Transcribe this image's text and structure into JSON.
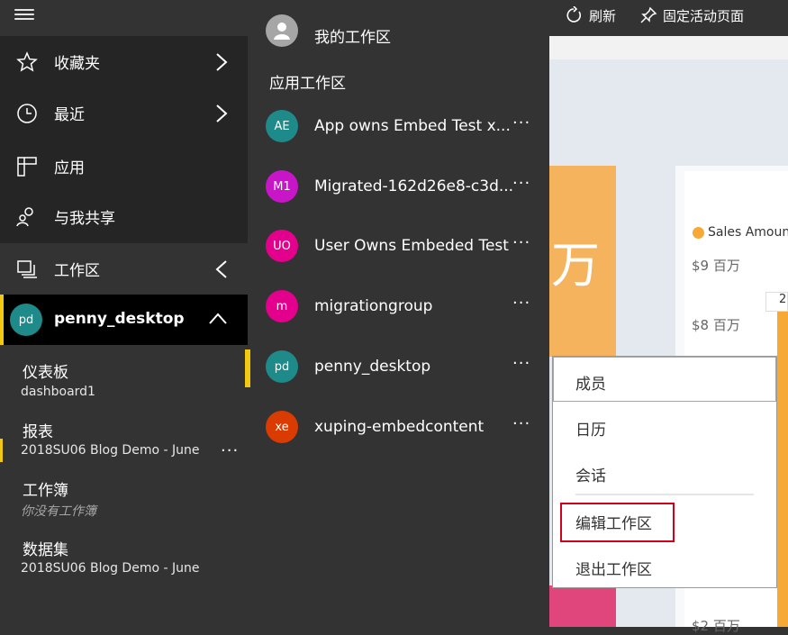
{
  "topbar": {
    "refresh_label": "刷新",
    "pin_label": "固定活动页面"
  },
  "nav": {
    "favorites": "收藏夹",
    "recent": "最近",
    "apps": "应用",
    "shared": "与我共享",
    "workspaces": "工作区"
  },
  "active_workspace": {
    "initials": "pd",
    "name": "penny_desktop",
    "sections": {
      "dashboards_title": "仪表板",
      "dashboards_item": "dashboard1",
      "reports_title": "报表",
      "reports_item": "2018SU06 Blog Demo - June",
      "workbooks_title": "工作簿",
      "workbooks_empty": "你没有工作簿",
      "datasets_title": "数据集",
      "datasets_item": "2018SU06 Blog Demo - June"
    },
    "more": "···"
  },
  "panel": {
    "my_workspace": "我的工作区",
    "app_workspaces_title": "应用工作区",
    "items": [
      {
        "initials": "AE",
        "name": "App owns Embed Test x...",
        "color": "#1f8a8a",
        "more": "···"
      },
      {
        "initials": "M1",
        "name": "Migrated-162d26e8-c3d...",
        "color": "#c815c8",
        "more": "···"
      },
      {
        "initials": "UO",
        "name": "User Owns Embeded Test",
        "color": "#e3008c",
        "more": "···"
      },
      {
        "initials": "m",
        "name": "migrationgroup",
        "color": "#e3008c",
        "more": "···"
      },
      {
        "initials": "pd",
        "name": "penny_desktop",
        "color": "#1f8a8a",
        "more": "···"
      },
      {
        "initials": "xe",
        "name": "xuping-embedcontent",
        "color": "#da3b01",
        "more": "···"
      }
    ]
  },
  "context_menu": {
    "members": "成员",
    "calendar": "日历",
    "conversations": "会话",
    "edit_workspace": "编辑工作区",
    "leave_workspace": "退出工作区"
  },
  "report": {
    "tile_text": "万",
    "legend": "Sales Amoun",
    "yticks": [
      "$9 百万",
      "$8 百万",
      "$2 百万"
    ],
    "bar_label": "2",
    "legend_color": "#f6a934"
  }
}
